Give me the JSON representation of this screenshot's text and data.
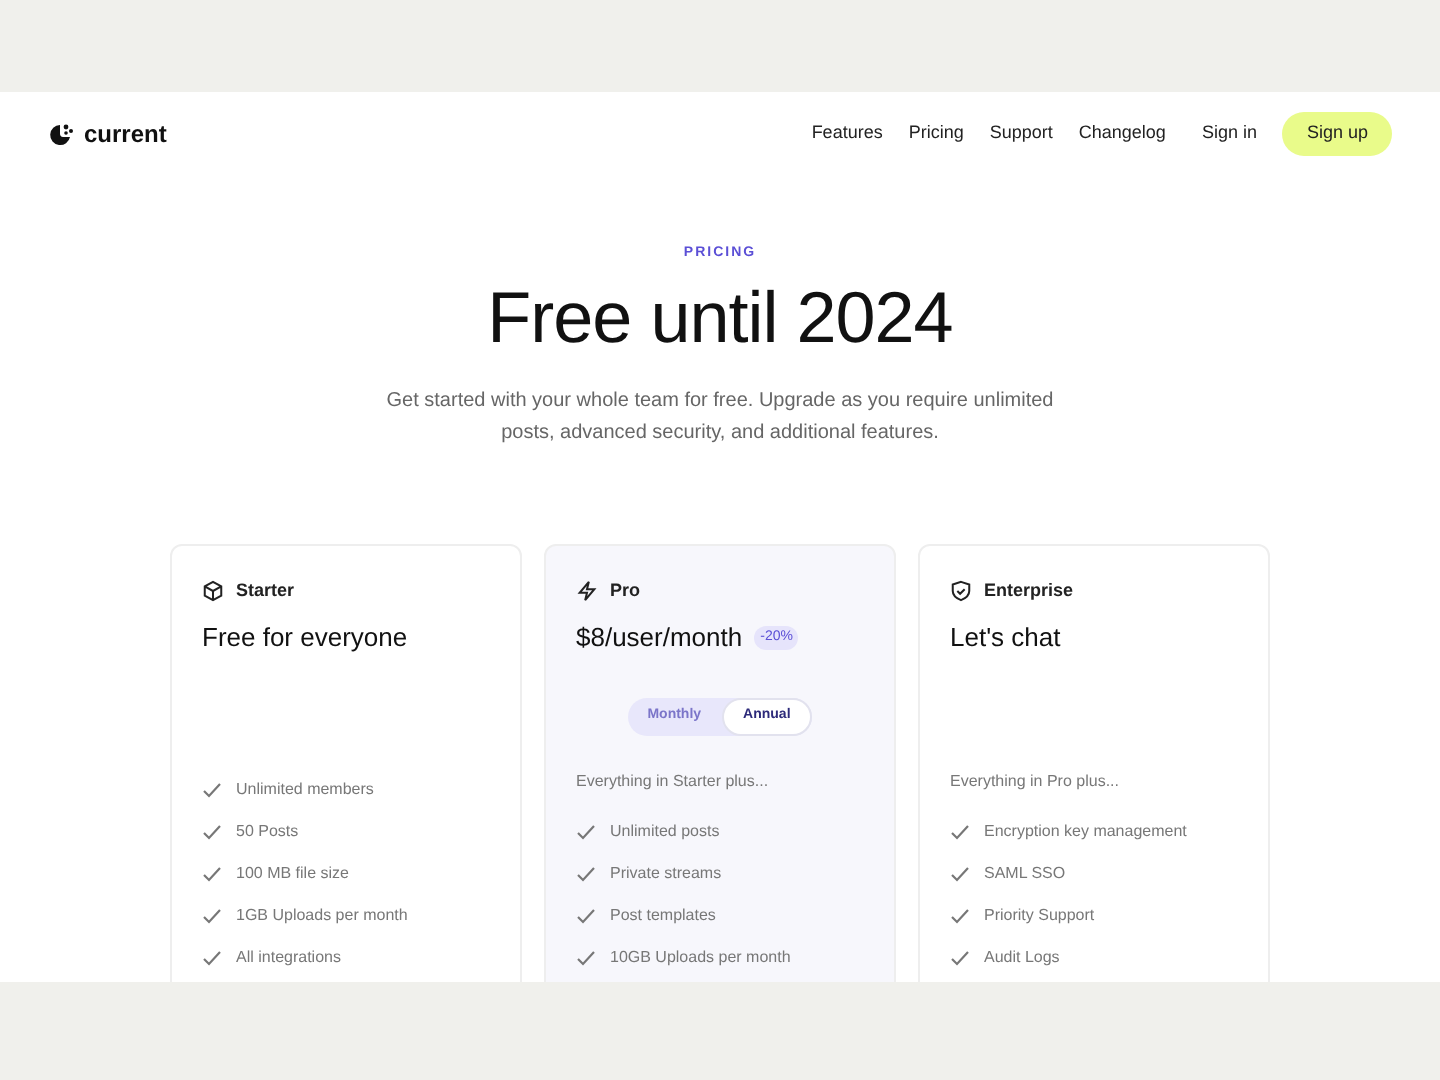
{
  "brand": "current",
  "nav": {
    "links": [
      "Features",
      "Pricing",
      "Support",
      "Changelog"
    ],
    "sign_in": "Sign in",
    "sign_up": "Sign up"
  },
  "hero": {
    "eyebrow": "PRICING",
    "title": "Free until 2024",
    "subtitle": "Get started with your whole team for free. Upgrade as you require unlimited posts, advanced security, and additional features."
  },
  "plans": [
    {
      "kind": "cube",
      "name": "Starter",
      "price": "Free for everyone",
      "features": [
        "Unlimited members",
        "50 Posts",
        "100 MB file size",
        "1GB Uploads per month",
        "All integrations"
      ]
    },
    {
      "kind": "bolt",
      "name": "Pro",
      "price": "$8/user/month",
      "badge": "-20%",
      "highlighted": true,
      "billing": [
        {
          "label": "Monthly",
          "selected": false
        },
        {
          "label": "Annual",
          "selected": true
        }
      ],
      "intro": "Everything in Starter plus...",
      "features": [
        "Unlimited posts",
        "Private streams",
        "Post templates",
        "10GB Uploads per month"
      ]
    },
    {
      "kind": "shield",
      "name": "Enterprise",
      "price": "Let's chat",
      "intro": "Everything in Pro plus...",
      "features": [
        "Encryption key management",
        "SAML SSO",
        "Priority Support",
        "Audit Logs"
      ]
    }
  ]
}
